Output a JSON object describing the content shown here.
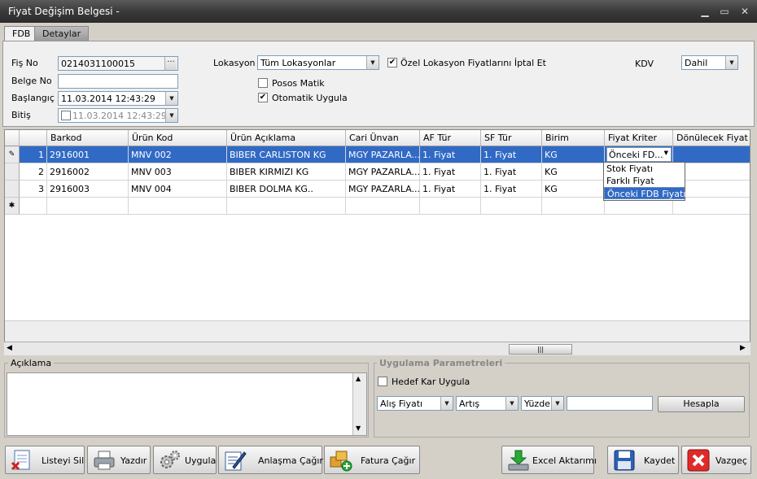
{
  "window": {
    "title": "Fiyat Değişim Belgesi -",
    "min": "▁",
    "max": "▭",
    "close": "✕"
  },
  "tabs": [
    {
      "label": "FDB"
    },
    {
      "label": "Detaylar"
    }
  ],
  "form": {
    "fis_no_label": "Fiş No",
    "fis_no_value": "0214031100015",
    "fis_no_btn": "···",
    "belge_no_label": "Belge No",
    "belge_no_value": "",
    "baslangic_label": "Başlangıç",
    "baslangic_value": "11.03.2014 12:43:29",
    "bitis_label": "Bitiş",
    "bitis_value": "11.03.2014 12:43:29",
    "lokasyon_label": "Lokasyon",
    "lokasyon_value": "Tüm Lokasyonlar",
    "ozel_lokasyon_label": "Özel Lokasyon Fiyatlarını İptal Et",
    "ozel_lokasyon_checked": true,
    "posos_label": "Posos Matik",
    "posos_checked": false,
    "otomatik_label": "Otomatik Uygula",
    "otomatik_checked": true,
    "kdv_label": "KDV",
    "kdv_value": "Dahil"
  },
  "grid": {
    "columns": [
      "Barkod",
      "Ürün Kod",
      "Ürün Açıklama",
      "Cari Ünvan",
      "AF Tür",
      "SF Tür",
      "Birim",
      "Fiyat Kriter",
      "Dönülecek Fiyat"
    ],
    "rows": [
      {
        "no": "1",
        "barkod": "2916001",
        "urun_kod": "MNV 002",
        "aciklama": "BIBER CARLISTON KG",
        "cari": "MGY PAZARLA...",
        "af": "1. Fiyat",
        "sf": "1. Fiyat",
        "birim": "KG",
        "kriter": "Önceki FD...",
        "donulecek": ""
      },
      {
        "no": "2",
        "barkod": "2916002",
        "urun_kod": "MNV 003",
        "aciklama": "BIBER KIRMIZI KG",
        "cari": "MGY PAZARLA...",
        "af": "1. Fiyat",
        "sf": "1. Fiyat",
        "birim": "KG",
        "kriter": "",
        "donulecek": ""
      },
      {
        "no": "3",
        "barkod": "2916003",
        "urun_kod": "MNV 004",
        "aciklama": "BIBER DOLMA KG..",
        "cari": "MGY PAZARLA...",
        "af": "1. Fiyat",
        "sf": "1. Fiyat",
        "birim": "KG",
        "kriter": "",
        "donulecek": ""
      }
    ],
    "new_row_marker": "✱",
    "edit_marker": "✎",
    "kriter_options": [
      "Stok Fiyatı",
      "Farklı Fiyat",
      "Önceki FDB Fiyatı"
    ],
    "kriter_selected": "Önceki FDB Fiyatı"
  },
  "aciklama": {
    "title": "Açıklama",
    "value": ""
  },
  "params": {
    "title": "Uygulama Parametreleri",
    "hedef_label": "Hedef Kar Uygula",
    "hedef_checked": false,
    "fiyat_value": "Alış Fiyatı",
    "yon_value": "Artış",
    "tip_value": "Yüzde",
    "amount_value": "",
    "hesapla_label": "Hesapla"
  },
  "toolbar": {
    "listeyi_sil": "Listeyi Sil",
    "yazdir": "Yazdır",
    "uygula": "Uygula",
    "anlasma_cagir": "Anlaşma Çağır",
    "fatura_cagir": "Fatura Çağır",
    "excel_aktarimi": "Excel Aktarımı",
    "kaydet": "Kaydet",
    "vazgec": "Vazgeç"
  }
}
